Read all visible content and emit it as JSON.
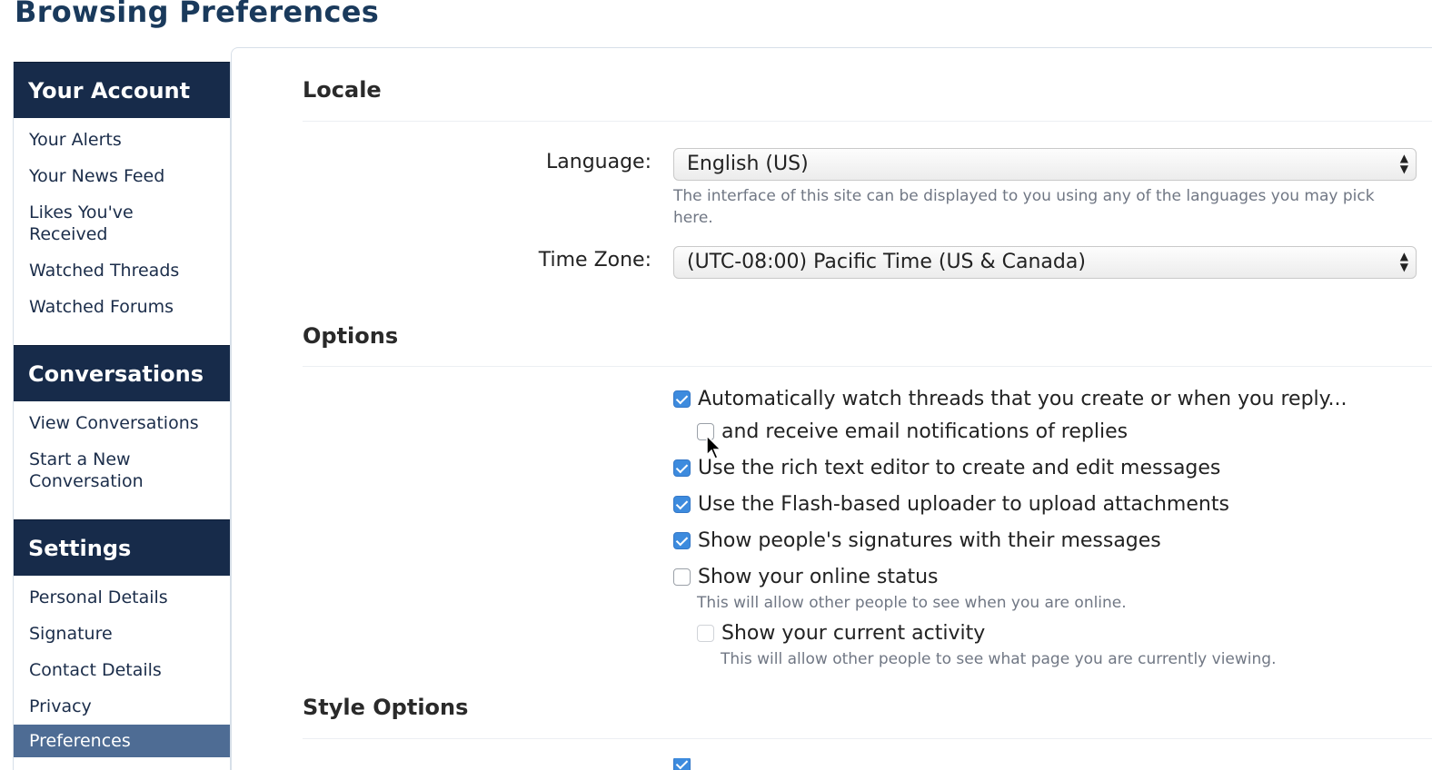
{
  "page": {
    "title": "Browsing Preferences"
  },
  "sidebar": {
    "sections": [
      {
        "header": "Your Account",
        "items": [
          "Your Alerts",
          "Your News Feed",
          "Likes You've Received",
          "Watched Threads",
          "Watched Forums"
        ]
      },
      {
        "header": "Conversations",
        "items": [
          "View Conversations",
          "Start a New Conversation"
        ]
      },
      {
        "header": "Settings",
        "items": [
          "Personal Details",
          "Signature",
          "Contact Details",
          "Privacy",
          "Preferences"
        ],
        "active_item": "Preferences"
      }
    ]
  },
  "locale": {
    "heading": "Locale",
    "language_label": "Language:",
    "language_value": "English (US)",
    "language_hint": "The interface of this site can be displayed to you using any of the languages you may pick here.",
    "timezone_label": "Time Zone:",
    "timezone_value": "(UTC-08:00) Pacific Time (US & Canada)"
  },
  "options": {
    "heading": "Options",
    "items": [
      {
        "label": "Automatically watch threads that you create or when you reply...",
        "checked": true
      },
      {
        "label": "and receive email notifications of replies",
        "checked": false,
        "indented": true
      },
      {
        "label": "Use the rich text editor to create and edit messages",
        "checked": true
      },
      {
        "label": "Use the Flash-based uploader to upload attachments",
        "checked": true
      },
      {
        "label": "Show people's signatures with their messages",
        "checked": true
      },
      {
        "label": "Show your online status",
        "checked": false,
        "hint": "This will allow other people to see when you are online."
      },
      {
        "label": "Show your current activity",
        "checked": false,
        "indented": true,
        "disabled": true,
        "hint": "This will allow other people to see what page you are currently viewing."
      }
    ]
  },
  "style_options": {
    "heading": "Style Options"
  },
  "colors": {
    "navy": "#172b4a",
    "accent": "#3d8bde",
    "active": "#4e6c94"
  },
  "icons": {
    "select": "updown-arrows-icon",
    "cursor": "mouse-pointer-icon"
  }
}
